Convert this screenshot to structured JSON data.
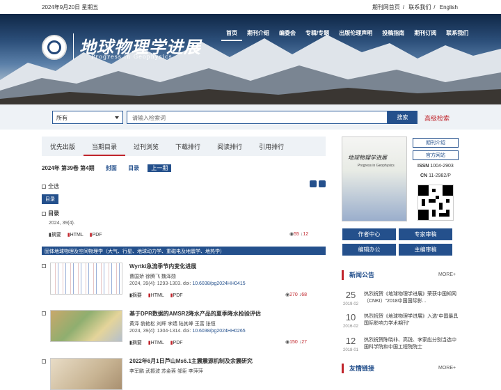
{
  "topbar": {
    "date": "2024年9月20日 星期五",
    "links": [
      "期刊网首页",
      "联系我们",
      "English"
    ],
    "sep": "/"
  },
  "header": {
    "brand_cn": "地球物理学进展",
    "brand_en": "Progress in Geophysics"
  },
  "nav": [
    "首页",
    "期刊介绍",
    "编委会",
    "专辑/专题",
    "出版伦理声明",
    "投稿指南",
    "期刊订阅",
    "联系我们"
  ],
  "search": {
    "select": "所有",
    "placeholder": "请输入检索词",
    "button": "搜索",
    "advanced": "高级检索"
  },
  "tabs": [
    "优先出版",
    "当期目录",
    "过刊浏览",
    "下载排行",
    "阅读排行",
    "引用排行"
  ],
  "issue": {
    "label": "2024年 第39卷 第4期",
    "cover": "封面",
    "toc": "目录",
    "prev": "上一期"
  },
  "select_all": "全选",
  "toc_label": "目录",
  "toc_entry": {
    "title": "目录",
    "cite": "2024, 39(4).",
    "views": "55",
    "downloads": "12"
  },
  "actions": {
    "abstract": "摘要",
    "html": "HTML",
    "pdf": "PDF"
  },
  "section": "固体地球物理及空间物理学（大气、行星、地球动力学、重磁电及地震学、地热学）",
  "articles": [
    {
      "title": "Wyrtki急流季节内变化进展",
      "authors": "曹国娇  徐腾飞  魏泽勋",
      "cite": "2024, 39(4): 1293-1303. doi:",
      "doi": "10.6038/pg2024HH0415",
      "views": "270",
      "downloads": "68"
    },
    {
      "title": "基于DPR数据的AMSR2降水产品的夏季降水检验评估",
      "authors": "黄泽  貌艳松  刘辉  李嫱  陆其峰  王富  张恒",
      "cite": "2024, 39(4): 1304-1314. doi:",
      "doi": "10.6038/pg2024HH0265",
      "views": "150",
      "downloads": "27"
    },
    {
      "title": "2022年6月1日芦山Ms6.1主震震源机制及余震研究",
      "authors": "李军鹏  武振波  苏金蓉  邹臣  李萍萍",
      "cite": "",
      "doi": "",
      "views": "",
      "downloads": ""
    }
  ],
  "sidebar": {
    "cover_title": "地球物理学进展",
    "cover_sub": "Progress in Geophysics",
    "btn_intro": "期刊介绍",
    "btn_site": "官方网站",
    "issn_label": "ISSN",
    "issn": "1004-2903",
    "cn_label": "CN",
    "cn": "11-2982/P",
    "blue": [
      "作者中心",
      "专家审稿",
      "编辑办公",
      "主编审稿"
    ],
    "news_title": "新闻公告",
    "more": "MORE+",
    "news": [
      {
        "day": "25",
        "ym": "2019-02",
        "text": "热烈祝贺《地球物理学进展》荣获中国知网（CNKI）“2018中国国际影..."
      },
      {
        "day": "10",
        "ym": "2016-02",
        "text": "热烈祝贺《地球物理学进展》入选“中国最具国际影响力学术期刊”"
      },
      {
        "day": "12",
        "ym": "2018-01",
        "text": "热烈祝贺陈晓非、高锐、李家彪分别当选中国科学院和中国工程院院士"
      }
    ],
    "links_title": "友情链接"
  }
}
